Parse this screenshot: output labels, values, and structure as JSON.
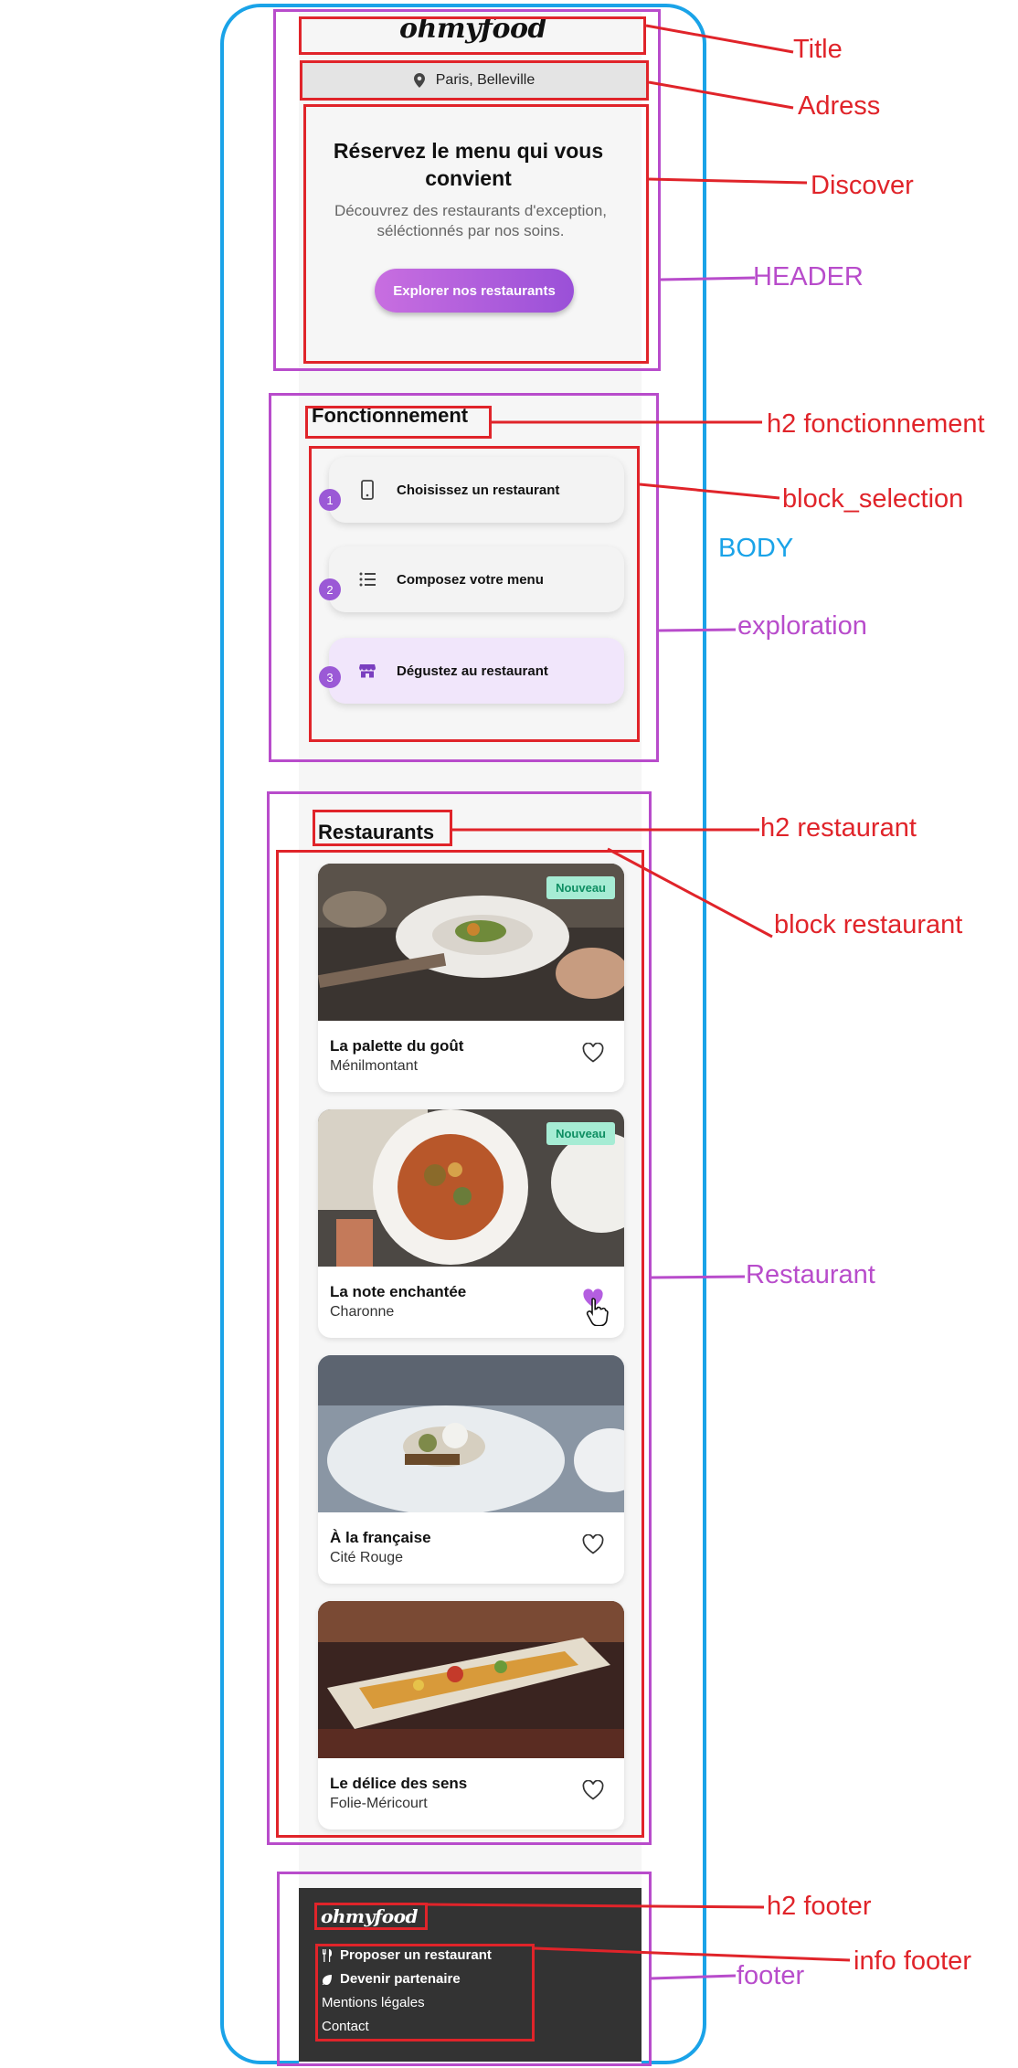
{
  "header": {
    "title": "ohmyfood",
    "address": "Paris, Belleville",
    "discover_title": "Réservez le menu qui vous convient",
    "discover_subtitle": "Découvrez des restaurants d'exception, séléctionnés par nos soins.",
    "explore_button": "Explorer nos restaurants"
  },
  "exploration": {
    "title": "Fonctionnement",
    "steps": [
      {
        "number": "1",
        "label": "Choisissez un restaurant",
        "icon": "mobile-icon"
      },
      {
        "number": "2",
        "label": "Composez votre menu",
        "icon": "list-icon"
      },
      {
        "number": "3",
        "label": "Dégustez au restaurant",
        "icon": "store-icon"
      }
    ]
  },
  "restaurants": {
    "title": "Restaurants",
    "items": [
      {
        "name": "La palette du goût",
        "location": "Ménilmontant",
        "badge": "Nouveau",
        "liked": false
      },
      {
        "name": "La note enchantée",
        "location": "Charonne",
        "badge": "Nouveau",
        "liked": true
      },
      {
        "name": "À la française",
        "location": "Cité Rouge",
        "badge": "",
        "liked": false
      },
      {
        "name": "Le délice des sens",
        "location": "Folie-Méricourt",
        "badge": "",
        "liked": false
      }
    ]
  },
  "footer": {
    "title": "ohmyfood",
    "links": [
      "Proposer un restaurant",
      "Devenir partenaire",
      "Mentions légales",
      "Contact"
    ]
  },
  "annotations": {
    "title": "Title",
    "adress": "Adress",
    "discover": "Discover",
    "header": "HEADER",
    "h2_fonctionnement": "h2 fonctionnement",
    "block_selection": "block_selection",
    "body": "BODY",
    "exploration": "exploration",
    "h2_restaurant": "h2 restaurant",
    "block_restaurant": "block restaurant",
    "restaurant": "Restaurant",
    "h2_footer": "h2 footer",
    "info_footer": "info footer",
    "footer": "footer"
  },
  "colors": {
    "primary_purple": "#9b59d6",
    "button_gradient_start": "#c86ee0",
    "badge_bg": "#a6ecd4",
    "badge_text": "#0e8e62",
    "annotation_red": "#e0242a",
    "annotation_purple": "#b84ccb",
    "annotation_blue": "#1aa3e8",
    "footer_bg": "#333333"
  }
}
